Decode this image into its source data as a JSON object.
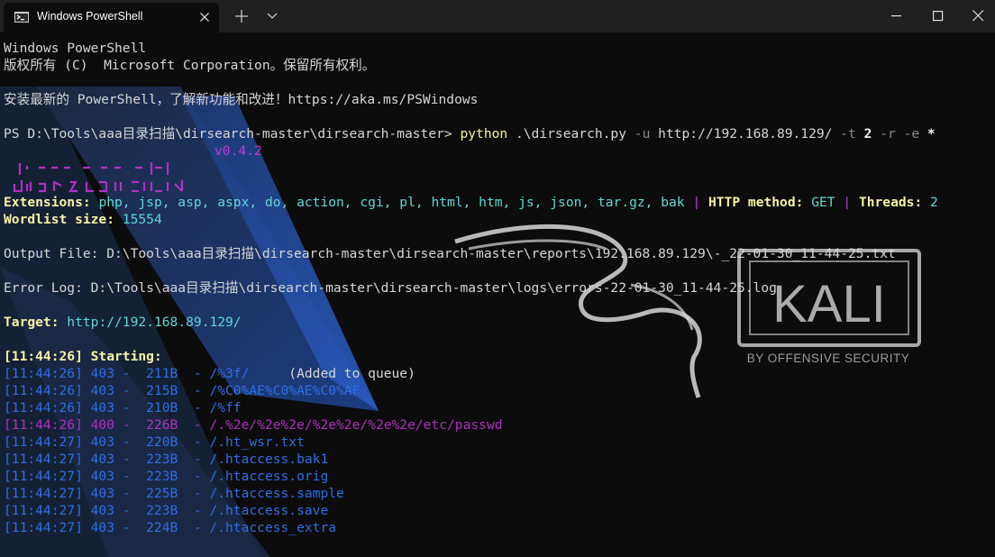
{
  "window": {
    "tab_title": "Windows PowerShell",
    "tab_icon": "powershell-icon",
    "new_tab_icon": "plus-icon",
    "dropdown_icon": "chevron-down-icon",
    "minimize_icon": "minimize-icon",
    "maximize_icon": "maximize-icon",
    "close_icon": "close-icon"
  },
  "terminal": {
    "header1": "Windows PowerShell",
    "header2": "版权所有 (C)  Microsoft Corporation。保留所有权利。",
    "header3": "安装最新的 PowerShell，了解新功能和改进！https://aka.ms/PSWindows",
    "prompt": "PS D:\\Tools\\aaa目录扫描\\dirsearch-master\\dirsearch-master> ",
    "cmd_python": "python",
    "cmd_script": " .\\dirsearch.py ",
    "cmd_u_flag": "-u",
    "cmd_url": " http://192.168.89.129/ ",
    "cmd_t_flag": "-t",
    "cmd_t_val": " 2 ",
    "cmd_r_flag": "-r",
    "cmd_sp": " ",
    "cmd_e_flag": "-e",
    "cmd_e_val": " *",
    "version": "v0.4.2",
    "ext_label": "Extensions: ",
    "ext_value": "php, jsp, asp, aspx, do, action, cgi, pl, html, htm, js, json, tar.gz, bak",
    "sep1": " | ",
    "http_label": "HTTP method: ",
    "http_value": "GET",
    "sep2": " | ",
    "threads_label": "Threads: ",
    "threads_value": "2",
    "wordlist_label": "Wordlist size: ",
    "wordlist_value": "15554",
    "output_line": "Output File: D:\\Tools\\aaa目录扫描\\dirsearch-master\\dirsearch-master\\reports\\192.168.89.129\\-_22-01-30_11-44-25.txt",
    "error_line": "Error Log: D:\\Tools\\aaa目录扫描\\dirsearch-master\\dirsearch-master\\logs\\errors-22-01-30_11-44-25.log",
    "target_label": "Target: ",
    "target_value": "http://192.168.89.129/",
    "starting": "[11:44:26] Starting:",
    "results": [
      {
        "text": "[11:44:26] 403 -  211B  - /%3f/",
        "extra": "     (Added to queue)",
        "color": "#2f6ee6"
      },
      {
        "text": "[11:44:26] 403 -  215B  - /%C0%AE%C0%AE%C0%AF",
        "extra": "",
        "color": "#2f6ee6"
      },
      {
        "text": "[11:44:26] 403 -  210B  - /%ff",
        "extra": "",
        "color": "#2f6ee6"
      },
      {
        "text": "[11:44:26] 400 -  226B  - /.%2e/%2e%2e/%2e%2e/%2e%2e/etc/passwd",
        "extra": "",
        "color": "#b12fc2"
      },
      {
        "text": "[11:44:27] 403 -  220B  - /.ht_wsr.txt",
        "extra": "",
        "color": "#2f6ee6"
      },
      {
        "text": "[11:44:27] 403 -  223B  - /.htaccess.bak1",
        "extra": "",
        "color": "#2f6ee6"
      },
      {
        "text": "[11:44:27] 403 -  223B  - /.htaccess.orig",
        "extra": "",
        "color": "#2f6ee6"
      },
      {
        "text": "[11:44:27] 403 -  225B  - /.htaccess.sample",
        "extra": "",
        "color": "#2f6ee6"
      },
      {
        "text": "[11:44:27] 403 -  223B  - /.htaccess.save",
        "extra": "",
        "color": "#2f6ee6"
      },
      {
        "text": "[11:44:27] 403 -  224B  - /.htaccess_extra",
        "extra": "",
        "color": "#2f6ee6"
      }
    ]
  },
  "background": {
    "kali_text": "KALI",
    "kali_sub": "BY OFFENSIVE SECURITY"
  }
}
